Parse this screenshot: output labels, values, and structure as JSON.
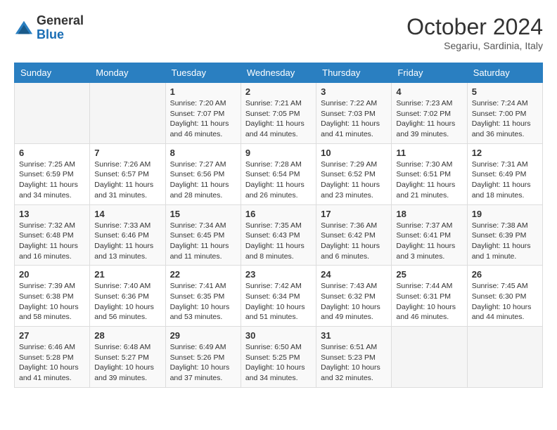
{
  "header": {
    "logo_general": "General",
    "logo_blue": "Blue",
    "month_title": "October 2024",
    "location": "Segariu, Sardinia, Italy"
  },
  "weekdays": [
    "Sunday",
    "Monday",
    "Tuesday",
    "Wednesday",
    "Thursday",
    "Friday",
    "Saturday"
  ],
  "weeks": [
    [
      {
        "num": "",
        "info": ""
      },
      {
        "num": "",
        "info": ""
      },
      {
        "num": "1",
        "info": "Sunrise: 7:20 AM\nSunset: 7:07 PM\nDaylight: 11 hours and 46 minutes."
      },
      {
        "num": "2",
        "info": "Sunrise: 7:21 AM\nSunset: 7:05 PM\nDaylight: 11 hours and 44 minutes."
      },
      {
        "num": "3",
        "info": "Sunrise: 7:22 AM\nSunset: 7:03 PM\nDaylight: 11 hours and 41 minutes."
      },
      {
        "num": "4",
        "info": "Sunrise: 7:23 AM\nSunset: 7:02 PM\nDaylight: 11 hours and 39 minutes."
      },
      {
        "num": "5",
        "info": "Sunrise: 7:24 AM\nSunset: 7:00 PM\nDaylight: 11 hours and 36 minutes."
      }
    ],
    [
      {
        "num": "6",
        "info": "Sunrise: 7:25 AM\nSunset: 6:59 PM\nDaylight: 11 hours and 34 minutes."
      },
      {
        "num": "7",
        "info": "Sunrise: 7:26 AM\nSunset: 6:57 PM\nDaylight: 11 hours and 31 minutes."
      },
      {
        "num": "8",
        "info": "Sunrise: 7:27 AM\nSunset: 6:56 PM\nDaylight: 11 hours and 28 minutes."
      },
      {
        "num": "9",
        "info": "Sunrise: 7:28 AM\nSunset: 6:54 PM\nDaylight: 11 hours and 26 minutes."
      },
      {
        "num": "10",
        "info": "Sunrise: 7:29 AM\nSunset: 6:52 PM\nDaylight: 11 hours and 23 minutes."
      },
      {
        "num": "11",
        "info": "Sunrise: 7:30 AM\nSunset: 6:51 PM\nDaylight: 11 hours and 21 minutes."
      },
      {
        "num": "12",
        "info": "Sunrise: 7:31 AM\nSunset: 6:49 PM\nDaylight: 11 hours and 18 minutes."
      }
    ],
    [
      {
        "num": "13",
        "info": "Sunrise: 7:32 AM\nSunset: 6:48 PM\nDaylight: 11 hours and 16 minutes."
      },
      {
        "num": "14",
        "info": "Sunrise: 7:33 AM\nSunset: 6:46 PM\nDaylight: 11 hours and 13 minutes."
      },
      {
        "num": "15",
        "info": "Sunrise: 7:34 AM\nSunset: 6:45 PM\nDaylight: 11 hours and 11 minutes."
      },
      {
        "num": "16",
        "info": "Sunrise: 7:35 AM\nSunset: 6:43 PM\nDaylight: 11 hours and 8 minutes."
      },
      {
        "num": "17",
        "info": "Sunrise: 7:36 AM\nSunset: 6:42 PM\nDaylight: 11 hours and 6 minutes."
      },
      {
        "num": "18",
        "info": "Sunrise: 7:37 AM\nSunset: 6:41 PM\nDaylight: 11 hours and 3 minutes."
      },
      {
        "num": "19",
        "info": "Sunrise: 7:38 AM\nSunset: 6:39 PM\nDaylight: 11 hours and 1 minute."
      }
    ],
    [
      {
        "num": "20",
        "info": "Sunrise: 7:39 AM\nSunset: 6:38 PM\nDaylight: 10 hours and 58 minutes."
      },
      {
        "num": "21",
        "info": "Sunrise: 7:40 AM\nSunset: 6:36 PM\nDaylight: 10 hours and 56 minutes."
      },
      {
        "num": "22",
        "info": "Sunrise: 7:41 AM\nSunset: 6:35 PM\nDaylight: 10 hours and 53 minutes."
      },
      {
        "num": "23",
        "info": "Sunrise: 7:42 AM\nSunset: 6:34 PM\nDaylight: 10 hours and 51 minutes."
      },
      {
        "num": "24",
        "info": "Sunrise: 7:43 AM\nSunset: 6:32 PM\nDaylight: 10 hours and 49 minutes."
      },
      {
        "num": "25",
        "info": "Sunrise: 7:44 AM\nSunset: 6:31 PM\nDaylight: 10 hours and 46 minutes."
      },
      {
        "num": "26",
        "info": "Sunrise: 7:45 AM\nSunset: 6:30 PM\nDaylight: 10 hours and 44 minutes."
      }
    ],
    [
      {
        "num": "27",
        "info": "Sunrise: 6:46 AM\nSunset: 5:28 PM\nDaylight: 10 hours and 41 minutes."
      },
      {
        "num": "28",
        "info": "Sunrise: 6:48 AM\nSunset: 5:27 PM\nDaylight: 10 hours and 39 minutes."
      },
      {
        "num": "29",
        "info": "Sunrise: 6:49 AM\nSunset: 5:26 PM\nDaylight: 10 hours and 37 minutes."
      },
      {
        "num": "30",
        "info": "Sunrise: 6:50 AM\nSunset: 5:25 PM\nDaylight: 10 hours and 34 minutes."
      },
      {
        "num": "31",
        "info": "Sunrise: 6:51 AM\nSunset: 5:23 PM\nDaylight: 10 hours and 32 minutes."
      },
      {
        "num": "",
        "info": ""
      },
      {
        "num": "",
        "info": ""
      }
    ]
  ]
}
